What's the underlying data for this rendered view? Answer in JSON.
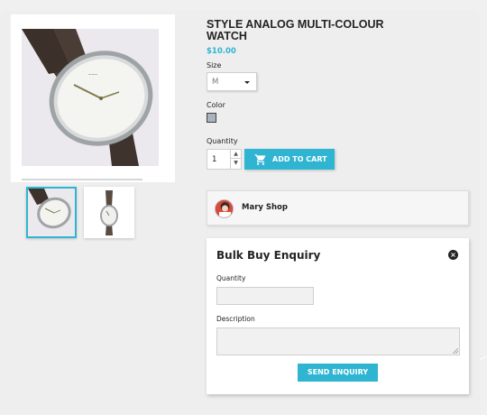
{
  "product": {
    "title": "STYLE ANALOG MULTI-COLOUR WATCH",
    "price": "$10.00"
  },
  "options": {
    "size_label": "Size",
    "size_value": "M",
    "color_label": "Color",
    "color_swatch": "#aab2bd",
    "quantity_label": "Quantity",
    "quantity_value": "1"
  },
  "cart": {
    "add_label": "ADD TO CART",
    "icon": "shopping-cart-icon"
  },
  "seller": {
    "name": "Mary Shop"
  },
  "enquiry": {
    "title": "Bulk Buy Enquiry",
    "quantity_label": "Quantity",
    "description_label": "Description",
    "send_label": "SEND ENQUIRY",
    "close_icon": "close-icon"
  },
  "colors": {
    "accent": "#2fb5d2",
    "text": "#232323",
    "background": "#f0f0f0"
  }
}
